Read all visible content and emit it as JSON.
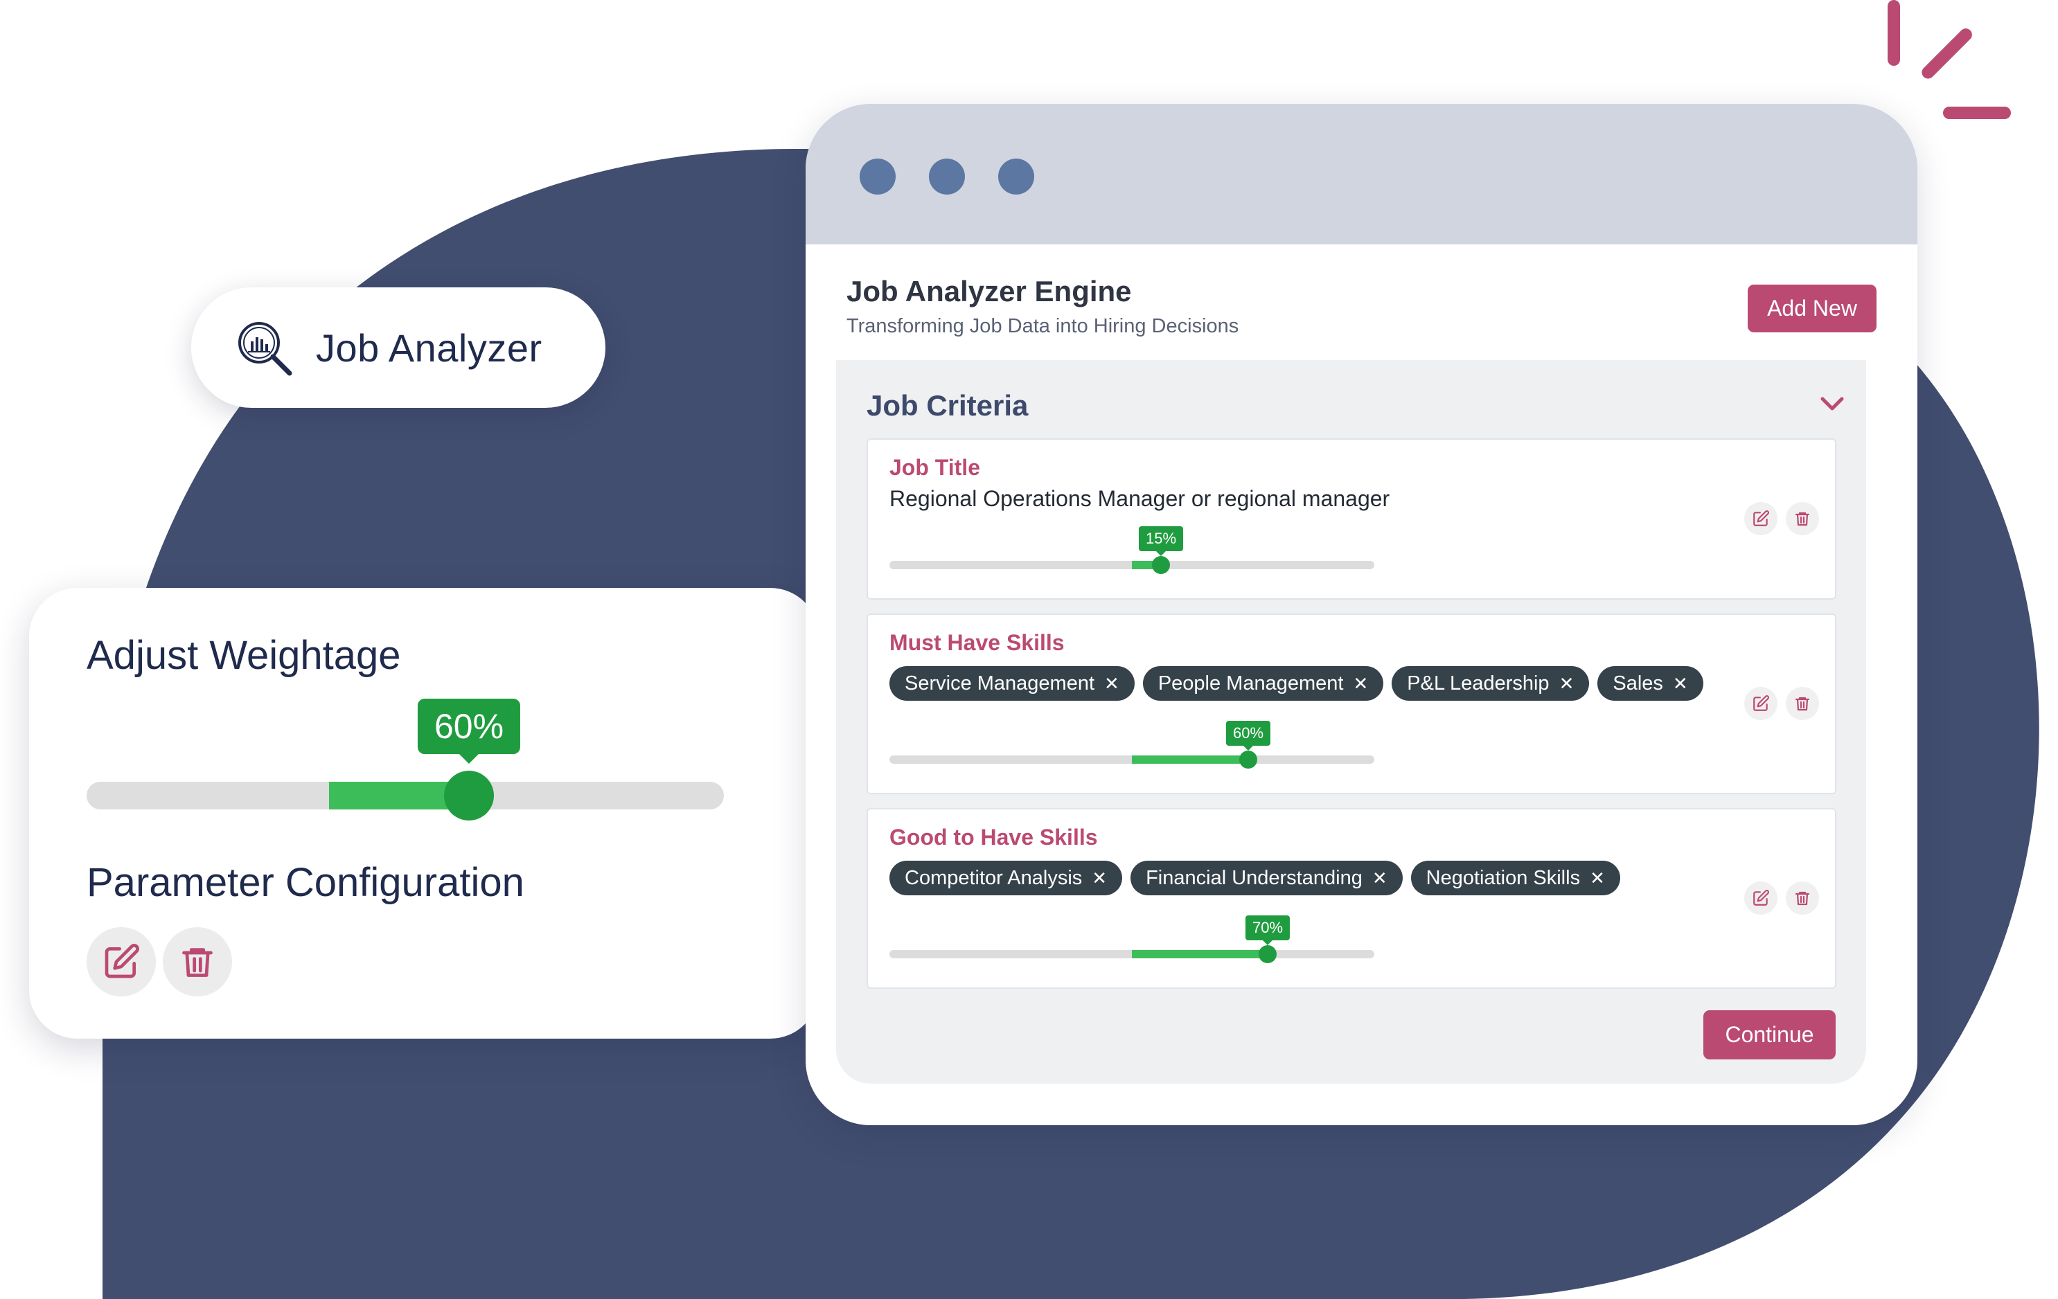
{
  "brand_colors": {
    "navy": "#424e70",
    "accent": "#bb4a72",
    "green": "#1f9c3f",
    "green_light": "#3dbd5a"
  },
  "pill": {
    "label": "Job Analyzer",
    "icon": "magnifier-chart-icon"
  },
  "weightage_card": {
    "title": "Adjust Weightage",
    "value": 0.6,
    "value_label": "60%",
    "section_title": "Parameter Configuration",
    "edit_icon": "edit-icon",
    "delete_icon": "trash-icon"
  },
  "window": {
    "title": "Job Analyzer Engine",
    "subtitle": "Transforming Job Data into Hiring Decisions",
    "add_new_label": "Add New",
    "panel_title": "Job Criteria",
    "continue_label": "Continue",
    "criteria": [
      {
        "title": "Job Title",
        "text": "Regional Operations Manager or regional manager",
        "weight": 0.15,
        "weight_label": "15%"
      },
      {
        "title": "Must Have Skills",
        "chips": [
          "Service Management",
          "People Management",
          "P&L Leadership",
          "Sales"
        ],
        "weight": 0.6,
        "weight_label": "60%"
      },
      {
        "title": "Good to Have Skills",
        "chips": [
          "Competitor Analysis",
          "Financial Understanding",
          "Negotiation Skills"
        ],
        "weight": 0.7,
        "weight_label": "70%"
      }
    ]
  }
}
